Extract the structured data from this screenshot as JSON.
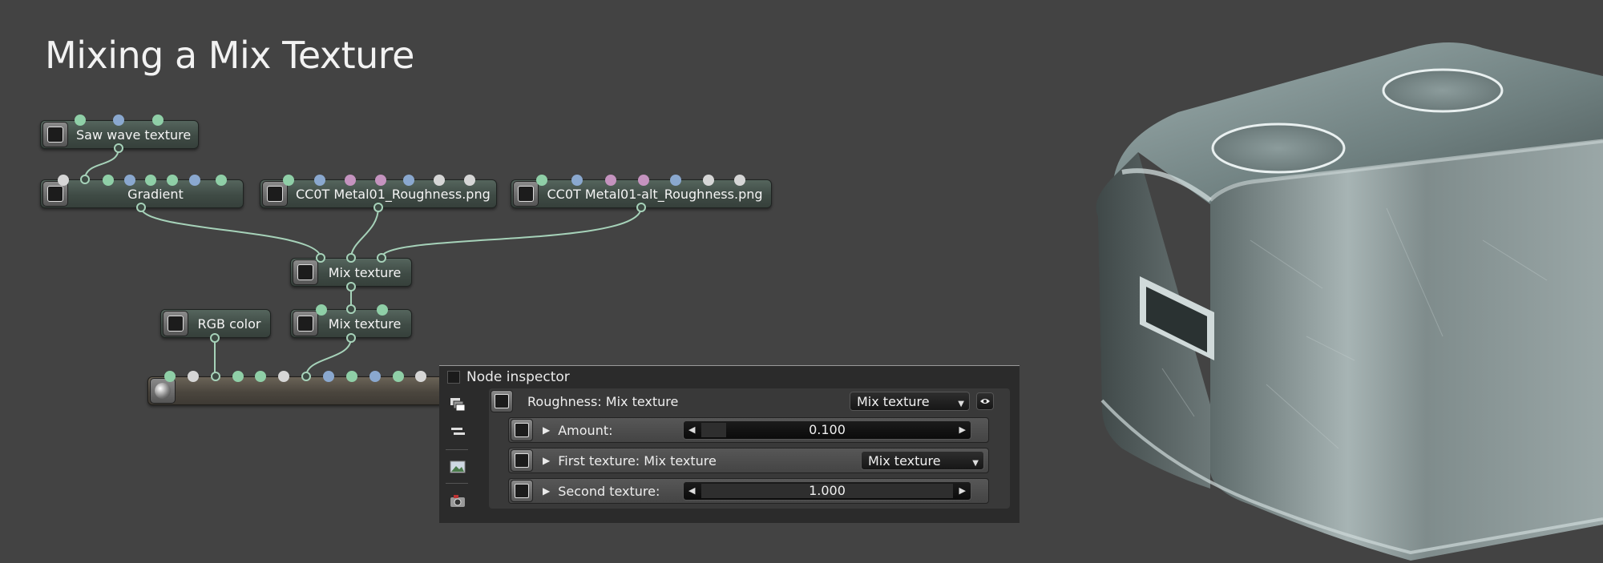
{
  "page": {
    "title": "Mixing a Mix Texture"
  },
  "graph": {
    "nodes": {
      "saw_wave": "Saw wave texture",
      "gradient": "Gradient",
      "metal_rough": "CC0T Metal01_Roughness.png",
      "metal_alt_rough": "CC0T Metal01-alt_Roughness.png",
      "mix_1": "Mix texture",
      "rgb_color": "RGB color",
      "mix_2": "Mix texture"
    },
    "pin_colors": {
      "green": "#8fcfa7",
      "blue": "#8aa8cf",
      "pink": "#c593bf",
      "white": "#d6d6d6"
    }
  },
  "inspector": {
    "title": "Node inspector",
    "header_label": "Roughness: Mix texture",
    "header_dropdown": "Mix texture",
    "rows": [
      {
        "label": "Amount:",
        "value": "0.100",
        "fraction": 0.1
      },
      {
        "label": "First texture: Mix texture",
        "dropdown": "Mix texture"
      },
      {
        "label": "Second texture:",
        "value": "1.000",
        "fraction": 1.0
      }
    ]
  },
  "colors": {
    "background": "#434343",
    "node_fill": "#46534c",
    "wire": "#a6d2b9",
    "panel": "#2b2b2b"
  }
}
